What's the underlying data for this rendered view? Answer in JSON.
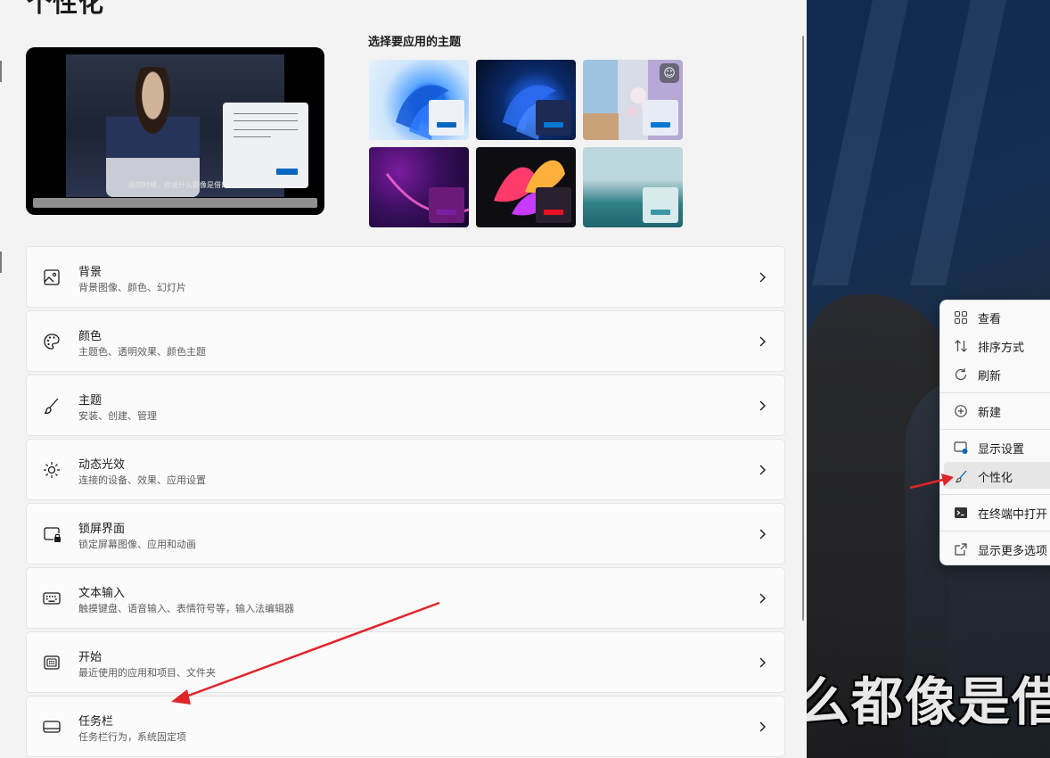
{
  "page": {
    "title": "个性化"
  },
  "preview": {
    "subtitle": "输的时候，你说什么都像是借口"
  },
  "themes": {
    "heading": "选择要应用的主题",
    "items": [
      {
        "name": "windows-light",
        "accent": "#0067c0"
      },
      {
        "name": "windows-dark",
        "accent": "#0078d4"
      },
      {
        "name": "glow",
        "accent": "#0078d4"
      },
      {
        "name": "captured-motion",
        "accent": "#7b1fa2"
      },
      {
        "name": "flow",
        "accent": "#e81123"
      },
      {
        "name": "sunrise",
        "accent": "#3a97a6"
      }
    ]
  },
  "settings_rows": [
    {
      "title": "背景",
      "desc": "背景图像、颜色、幻灯片",
      "icon": "image-icon"
    },
    {
      "title": "颜色",
      "desc": "主题色、透明效果、颜色主题",
      "icon": "palette-icon"
    },
    {
      "title": "主题",
      "desc": "安装、创建、管理",
      "icon": "brush-icon"
    },
    {
      "title": "动态光效",
      "desc": "连接的设备、效果、应用设置",
      "icon": "lighting-icon"
    },
    {
      "title": "锁屏界面",
      "desc": "锁定屏幕图像、应用和动画",
      "icon": "lock-screen-icon"
    },
    {
      "title": "文本输入",
      "desc": "触摸键盘、语音输入、表情符号等，输入法编辑器",
      "icon": "keyboard-icon"
    },
    {
      "title": "开始",
      "desc": "最近使用的应用和项目、文件夹",
      "icon": "start-icon"
    },
    {
      "title": "任务栏",
      "desc": "任务栏行为，系统固定项",
      "icon": "taskbar-icon"
    }
  ],
  "desktop": {
    "subtitle": "么都像是借口"
  },
  "context_menu": {
    "items": [
      {
        "label": "查看",
        "icon": "grid-icon"
      },
      {
        "label": "排序方式",
        "icon": "sort-icon"
      },
      {
        "label": "刷新",
        "icon": "refresh-icon"
      },
      {
        "label": "新建",
        "icon": "new-icon"
      },
      {
        "label": "显示设置",
        "icon": "display-settings-icon"
      },
      {
        "label": "个性化",
        "icon": "brush-icon"
      },
      {
        "label": "在终端中打开",
        "icon": "terminal-icon"
      },
      {
        "label": "显示更多选项",
        "icon": "more-options-icon"
      }
    ]
  },
  "colors": {
    "accent": "#0067c0",
    "arrow": "#e0242a"
  }
}
